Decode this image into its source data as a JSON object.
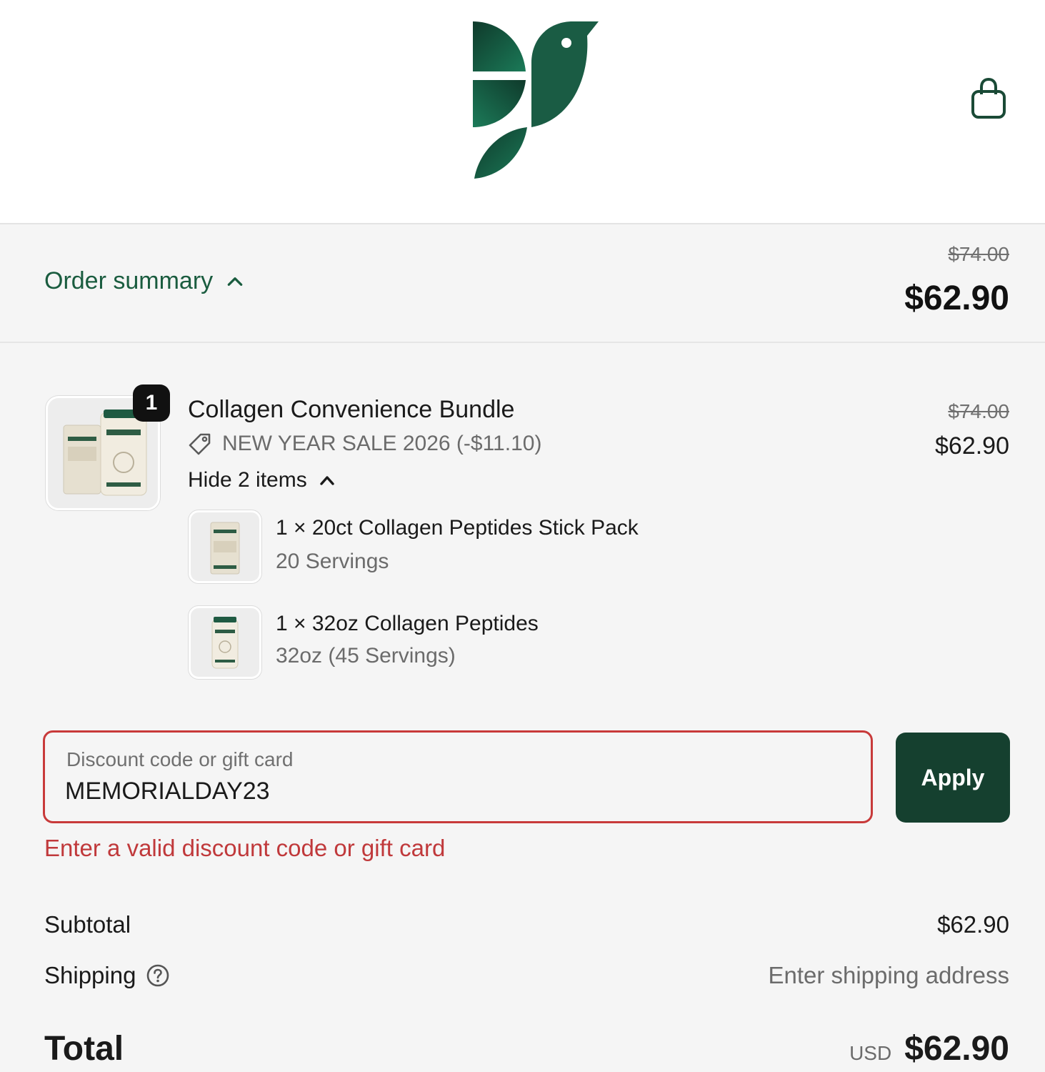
{
  "header": {
    "logo_icon": "bird-logo-icon",
    "cart_icon": "shopping-bag-icon"
  },
  "summary": {
    "toggle_label": "Order summary",
    "toggle_icon": "chevron-up-icon",
    "original_total": "$74.00",
    "total": "$62.90"
  },
  "product": {
    "quantity": "1",
    "title": "Collagen Convenience Bundle",
    "discount_icon": "tag-icon",
    "discount_label": "NEW YEAR SALE 2026 (-$11.10)",
    "hide_items_label": "Hide 2 items",
    "original_price": "$74.00",
    "price": "$62.90",
    "components": [
      {
        "title": "1 × 20ct Collagen Peptides Stick Pack",
        "variant": "20 Servings"
      },
      {
        "title": "1 × 32oz Collagen Peptides",
        "variant": "32oz (45 Servings)"
      }
    ]
  },
  "discount": {
    "label": "Discount code or gift card",
    "value": "MEMORIALDAY23",
    "apply_label": "Apply",
    "error": "Enter a valid discount code or gift card"
  },
  "totals": {
    "subtotal_label": "Subtotal",
    "subtotal_value": "$62.90",
    "shipping_label": "Shipping",
    "shipping_icon": "question-circle-icon",
    "shipping_value": "Enter shipping address",
    "total_label": "Total",
    "currency": "USD",
    "total_value": "$62.90"
  },
  "colors": {
    "brand_green": "#15402f",
    "link_green": "#1a5c3f",
    "error_red": "#c0393b"
  }
}
